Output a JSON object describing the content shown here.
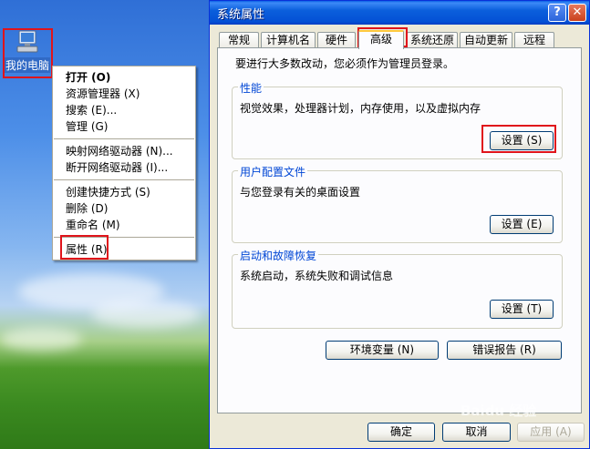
{
  "desktop": {
    "icon_label": "我的电脑"
  },
  "context_menu": {
    "items": [
      {
        "label": "打开 (O)",
        "bold": true
      },
      {
        "label": "资源管理器 (X)"
      },
      {
        "label": "搜索 (E)..."
      },
      {
        "label": "管理 (G)"
      },
      {
        "label": "映射网络驱动器 (N)..."
      },
      {
        "label": "断开网络驱动器 (I)..."
      },
      {
        "label": "创建快捷方式 (S)"
      },
      {
        "label": "删除 (D)"
      },
      {
        "label": "重命名 (M)"
      },
      {
        "label": "属性 (R)"
      }
    ]
  },
  "window": {
    "title": "系统属性",
    "help_label": "?",
    "close_label": "✕",
    "tabs": [
      "常规",
      "计算机名",
      "硬件",
      "高级",
      "系统还原",
      "自动更新",
      "远程"
    ],
    "notice": "要进行大多数改动，您必须作为管理员登录。",
    "performance": {
      "legend": "性能",
      "desc": "视觉效果，处理器计划，内存使用，以及虚拟内存",
      "button": "设置 (S)"
    },
    "user_profiles": {
      "legend": "用户配置文件",
      "desc": "与您登录有关的桌面设置",
      "button": "设置 (E)"
    },
    "startup_recovery": {
      "legend": "启动和故障恢复",
      "desc": "系统启动，系统失败和调试信息",
      "button": "设置 (T)"
    },
    "env_button": "环境变量 (N)",
    "error_report_button": "错误报告 (R)",
    "ok_button": "确定",
    "cancel_button": "取消",
    "apply_button": "应用 (A)"
  },
  "watermark": "Baidu 经验",
  "colors": {
    "highlight_box": "#e0141b",
    "titlebar": "#0450d5",
    "group_legend": "#0046d5"
  }
}
